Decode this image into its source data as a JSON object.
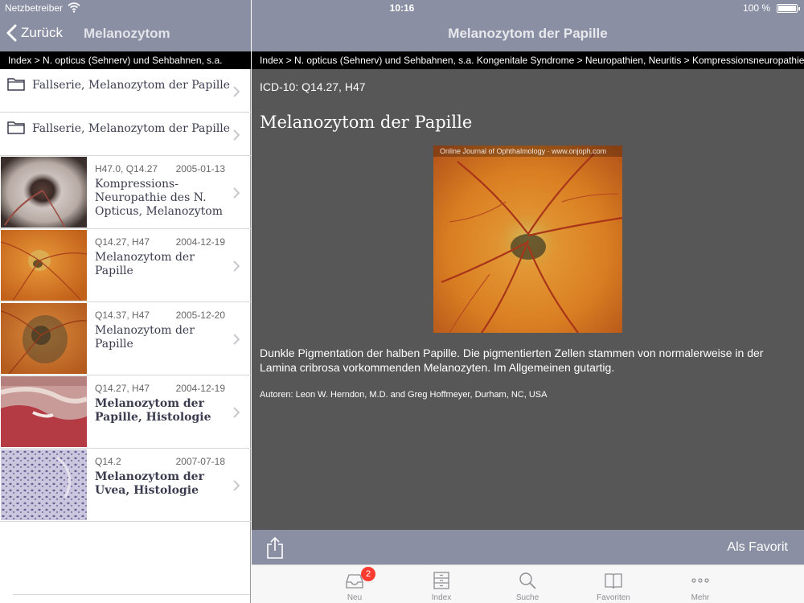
{
  "status_bar": {
    "carrier": "Netzbetreiber",
    "time": "10:16",
    "battery": "100 %"
  },
  "left": {
    "back_label": "Zurück",
    "title": "Melanozytom",
    "breadcrumb": "Index > N. opticus (Sehnerv) und Sehbahnen, s.a.",
    "folders": [
      {
        "label": "Fallserie, Melanozytom der Papille"
      },
      {
        "label": "Fallserie, Melanozytom der Papille"
      }
    ],
    "entries": [
      {
        "code": "H47.0, Q14.27",
        "date": "2005-01-13",
        "title": "Kompressions-Neuropathie des N. Opticus, Melanozytom",
        "bold": false
      },
      {
        "code": "Q14.27, H47",
        "date": "2004-12-19",
        "title": "Melanozytom der Papille",
        "bold": false
      },
      {
        "code": "Q14.37, H47",
        "date": "2005-12-20",
        "title": "Melanozytom der Papille",
        "bold": false
      },
      {
        "code": "Q14.27, H47",
        "date": "2004-12-19",
        "title": "Melanozytom der Papille, Histologie",
        "bold": true
      },
      {
        "code": "Q14.2",
        "date": "2007-07-18",
        "title": "Melanozytom der Uvea, Histologie",
        "bold": true
      }
    ]
  },
  "right": {
    "title": "Melanozytom der Papille",
    "breadcrumb": "Index > N. opticus (Sehnerv) und Sehbahnen, s.a. Kongenitale Syndrome > Neuropathien, Neuritis > Kompressionsneuropathie",
    "icd": "ICD-10: Q14.27, H47",
    "heading": "Melanozytom der Papille",
    "image_watermark": "Online Journal of Ophthalmology · www.onjoph.com",
    "description": "Dunkle Pigmentation der halben Papille. Die pigmentierten Zellen stammen von normalerweise in der Lamina cribrosa vorkommenden Melanozyten. Im Allgemeinen gutartig.",
    "authors": "Autoren: Leon W. Herndon, M.D. and Greg Hoffmeyer, Durham, NC, USA",
    "favorite_label": "Als Favorit"
  },
  "tabs": [
    {
      "label": "Neu",
      "icon": "inbox-icon",
      "badge": "2"
    },
    {
      "label": "Index",
      "icon": "cabinet-icon"
    },
    {
      "label": "Suche",
      "icon": "search-icon"
    },
    {
      "label": "Favoriten",
      "icon": "book-icon"
    },
    {
      "label": "Mehr",
      "icon": "more-icon"
    }
  ],
  "colors": {
    "navbar": "#8a8fa3",
    "content_bg": "#575757",
    "badge": "#ff3b30"
  }
}
